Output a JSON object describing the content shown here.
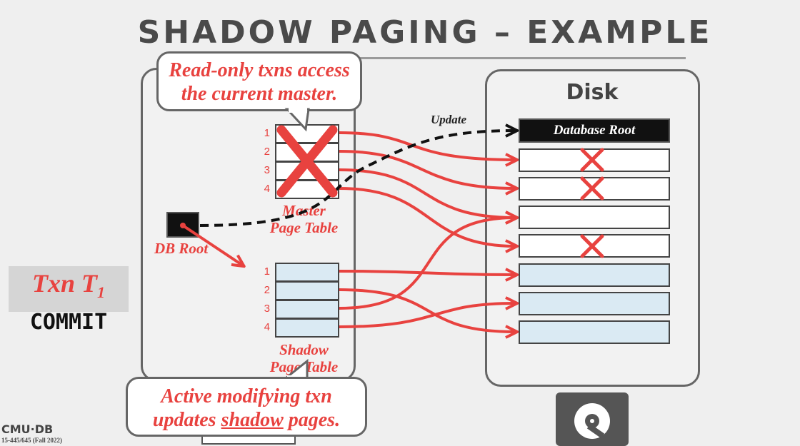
{
  "slide": {
    "title": "SHADOW PAGING – EXAMPLE",
    "footer_logo": "CMU·DB",
    "footer_course": "15-445/645 (Fall 2022)"
  },
  "callouts": {
    "top_line1": "Read-only txns access",
    "top_line2": "the current master.",
    "bottom_line1": "Active modifying txn",
    "bottom_line2_pre": "updates ",
    "bottom_line2_underlined": "shadow",
    "bottom_line2_post": " pages."
  },
  "txn": {
    "name": "Txn T",
    "subscript": "1",
    "status": "COMMIT"
  },
  "memory": {
    "db_root_label": "DB Root",
    "master_label_line1": "Master",
    "master_label_line2": "Page Table",
    "shadow_label_line1": "Shadow",
    "shadow_label_line2": "Page Table",
    "slot_indices": [
      "1",
      "2",
      "3",
      "4"
    ]
  },
  "disk": {
    "title": "Disk",
    "root_label": "Database Root",
    "update_label": "Update",
    "pages": [
      {
        "type": "master",
        "crossed": true
      },
      {
        "type": "master",
        "crossed": true
      },
      {
        "type": "master",
        "crossed": false
      },
      {
        "type": "master",
        "crossed": true
      },
      {
        "type": "shadow",
        "crossed": false
      },
      {
        "type": "shadow",
        "crossed": false
      },
      {
        "type": "shadow",
        "crossed": false
      }
    ]
  },
  "colors": {
    "accent": "#e8423f",
    "shadow_fill": "#daeaf3",
    "dark": "#111111",
    "frame": "#666666"
  }
}
